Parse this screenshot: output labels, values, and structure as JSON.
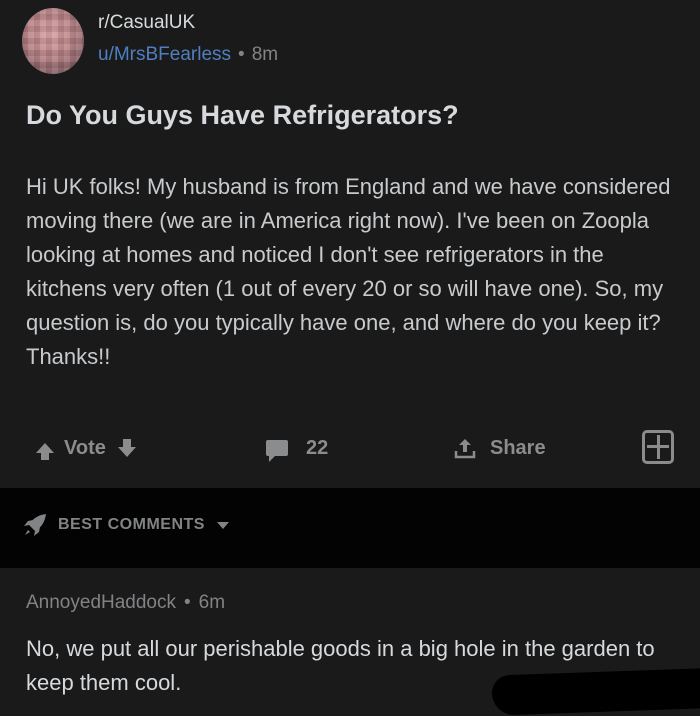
{
  "post": {
    "subreddit": "r/CasualUK",
    "username": "u/MrsBFearless",
    "separator": "•",
    "age": "8m",
    "title": "Do You Guys Have Refrigerators?",
    "body": "Hi UK folks! My husband is from England and we have considered moving there (we are in America right now). I've been on Zoopla looking at homes and noticed I don't see refrigerators in the kitchens very often (1 out of every 20 or so will have one). So, my question is, do you typically have one, and where do you keep it? Thanks!!"
  },
  "actions": {
    "vote_label": "Vote",
    "comment_count": "22",
    "share_label": "Share"
  },
  "sort": {
    "label": "BEST COMMENTS"
  },
  "comment": {
    "author": "AnnoyedHaddock",
    "separator": "•",
    "age": "6m",
    "text": "No, we put all our perishable goods in a big hole in the garden to keep them cool."
  },
  "colors": {
    "background": "#1a1a1b",
    "divider": "#030303",
    "username": "#4f7fbf",
    "muted": "#818384"
  },
  "icons": [
    "upvote-icon",
    "downvote-icon",
    "comment-icon",
    "share-icon",
    "award-icon",
    "rocket-icon",
    "caret-down-icon"
  ]
}
